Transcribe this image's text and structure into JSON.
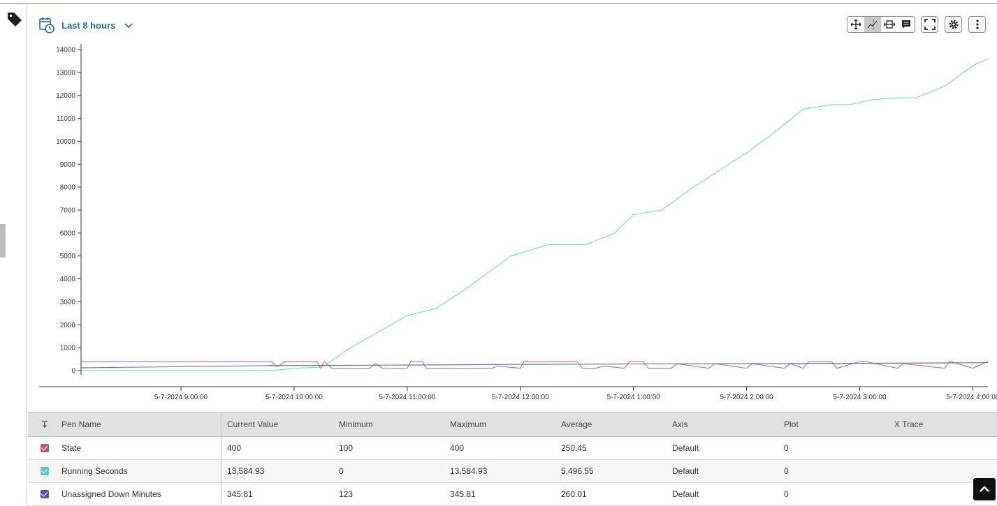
{
  "header": {
    "time_range": "Last 8 hours"
  },
  "icons": {
    "tag": "tag-icon",
    "calendar": "calendar-clock-icon",
    "chevron": "chevron-down-icon",
    "pan": "pan-icon",
    "trace": "x-trace-icon",
    "zoom": "zoom-horizontal-icon",
    "annotate": "annotation-icon",
    "fullscreen": "fullscreen-icon",
    "settings": "gear-icon",
    "more": "more-vertical-icon",
    "scroll_top": "chevron-up-icon",
    "sort": "sort-icon"
  },
  "chart_data": {
    "type": "line",
    "ylim": [
      0,
      14000
    ],
    "yticks": [
      "0",
      "1000",
      "2000",
      "3000",
      "4000",
      "5000",
      "6000",
      "7000",
      "8000",
      "9000",
      "10000",
      "11000",
      "12000",
      "13000",
      "14000"
    ],
    "xticks": [
      "5-7-2024 9:00:00",
      "5-7-2024 10:00:00",
      "5-7-2024 11:00:00",
      "5-7-2024 12:00:00",
      "5-7-2024 1:00:00",
      "5-7-2024 2:00:00",
      "5-7-2024 3:00:00",
      "5-7-2024 4:00:00"
    ],
    "x_range": [
      "5-7-2024 8:07:00",
      "5-7-2024 4:08:00"
    ],
    "series": [
      {
        "name": "Running Seconds",
        "color": "#7fd6c4",
        "x": [
          "8:07",
          "9:00",
          "9:30",
          "9:48",
          "10:00",
          "10:15",
          "10:30",
          "10:45",
          "11:00",
          "11:15",
          "11:30",
          "11:45",
          "11:55",
          "12:15",
          "12:25",
          "12:35",
          "12:50",
          "13:00",
          "13:15",
          "13:30",
          "13:45",
          "14:00",
          "14:15",
          "14:30",
          "14:45",
          "14:55",
          "15:05",
          "15:20",
          "15:30",
          "15:45",
          "16:00",
          "16:08"
        ],
        "y": [
          0,
          0,
          0,
          0,
          100,
          150,
          1000,
          1700,
          2400,
          2700,
          3500,
          4400,
          5000,
          5500,
          5500,
          5500,
          6000,
          6800,
          7000,
          7900,
          8700,
          9500,
          10400,
          11400,
          11600,
          11600,
          11800,
          11900,
          11900,
          12400,
          13300,
          13600
        ]
      },
      {
        "name": "State",
        "color": "#c96b86",
        "x": [
          "8:07",
          "9:48",
          "9:50",
          "9:52",
          "9:55",
          "10:05",
          "10:12",
          "10:14",
          "10:16",
          "10:20",
          "10:40",
          "10:43",
          "10:47",
          "11:00",
          "11:02",
          "11:08",
          "11:10",
          "11:45",
          "11:48",
          "12:00",
          "12:02",
          "12:30",
          "12:33",
          "12:40",
          "12:44",
          "12:55",
          "12:58",
          "13:05",
          "13:08",
          "13:20",
          "13:23",
          "13:40",
          "13:43",
          "14:00",
          "14:03",
          "14:20",
          "14:23",
          "14:30",
          "14:33",
          "14:45",
          "14:48",
          "15:00",
          "15:03",
          "15:20",
          "15:23",
          "15:45",
          "15:48",
          "16:00",
          "16:08"
        ],
        "y": [
          400,
          400,
          200,
          200,
          400,
          400,
          400,
          100,
          400,
          100,
          100,
          300,
          100,
          100,
          400,
          400,
          100,
          100,
          200,
          100,
          400,
          400,
          100,
          100,
          200,
          100,
          400,
          400,
          100,
          100,
          300,
          100,
          300,
          100,
          300,
          100,
          300,
          100,
          400,
          400,
          100,
          400,
          400,
          100,
          300,
          100,
          400,
          100,
          400
        ]
      },
      {
        "name": "Unassigned Down Minutes",
        "color": "#5a6aa8",
        "x": [
          "8:07",
          "9:48",
          "10:30",
          "11:00",
          "12:00",
          "13:00",
          "14:00",
          "15:00",
          "16:00",
          "16:08"
        ],
        "y": [
          123,
          220,
          230,
          240,
          270,
          290,
          300,
          320,
          340,
          346
        ]
      }
    ]
  },
  "table": {
    "columns": [
      "Pen Name",
      "Current Value",
      "Minimum",
      "Maximum",
      "Average",
      "Axis",
      "Plot",
      "X Trace"
    ],
    "rows": [
      {
        "color": "#c4556f",
        "name": "State",
        "current": "400",
        "min": "100",
        "max": "400",
        "avg": "250.45",
        "axis": "Default",
        "plot": "0",
        "xtrace": ""
      },
      {
        "color": "#5cc9c4",
        "name": "Running Seconds",
        "current": "13,584.93",
        "min": "0",
        "max": "13,584.93",
        "avg": "5,496.55",
        "axis": "Default",
        "plot": "0",
        "xtrace": ""
      },
      {
        "color": "#5a52b8",
        "name": "Unassigned Down Minutes",
        "current": "345.81",
        "min": "123",
        "max": "345.81",
        "avg": "260.01",
        "axis": "Default",
        "plot": "0",
        "xtrace": ""
      }
    ]
  }
}
